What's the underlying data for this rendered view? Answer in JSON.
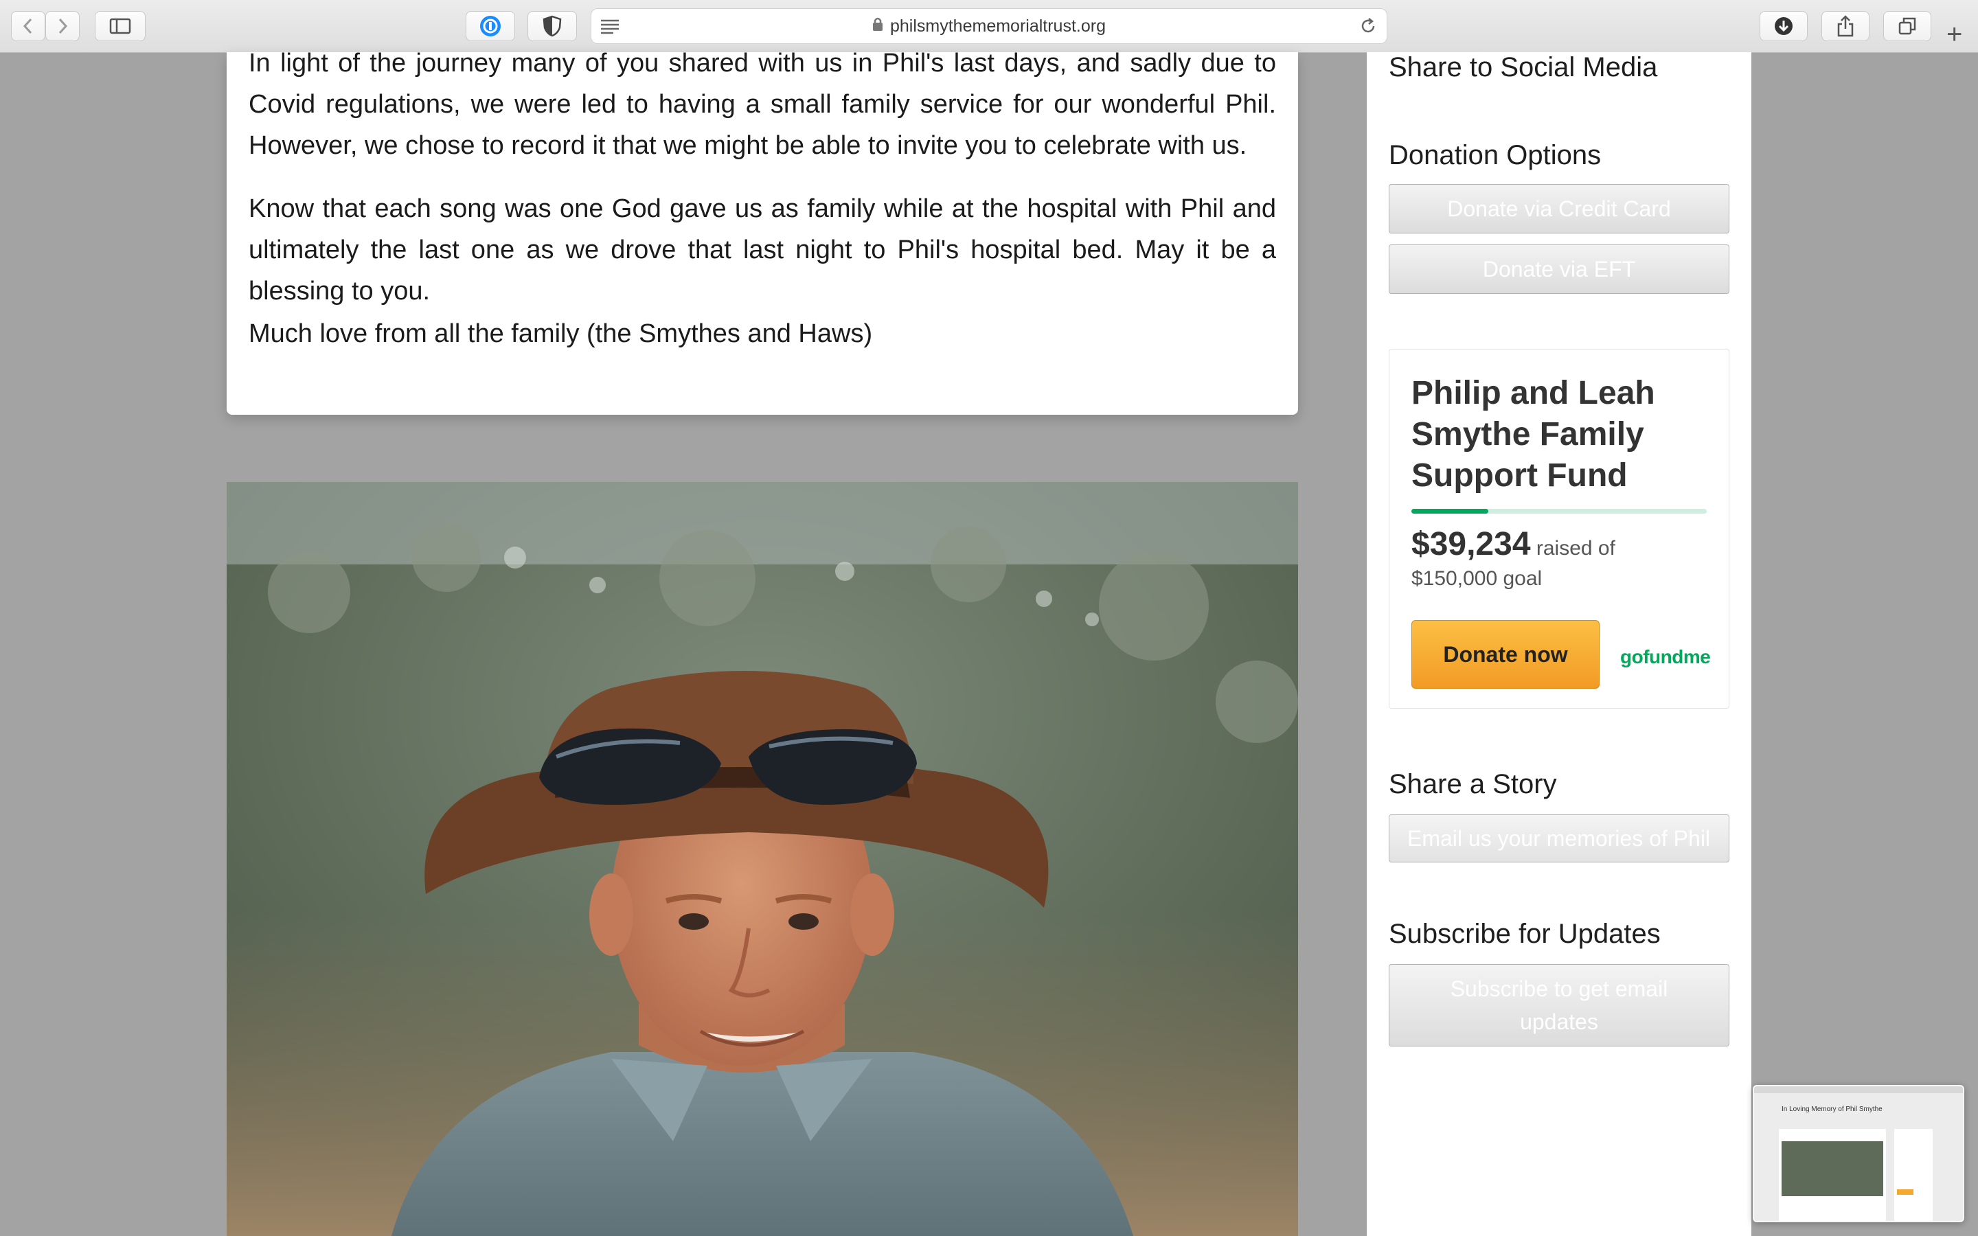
{
  "browser": {
    "url": "philsmythememorialtrust.org"
  },
  "article": {
    "paragraphs": [
      "In light of the journey many of you shared with us in Phil's last days, and sadly due to Covid regulations, we were led to having a small family service for our wonderful Phil. However, we chose to record it that we might be able to invite you to celebrate with us.",
      "Know that each song was one God gave us as family while at the hospital with Phil and ultimately the last one as we drove that last night to Phil's hospital bed. May it be a blessing to you.",
      "Much love from all the family (the Smythes and Haws)"
    ]
  },
  "sidebar": {
    "share_heading": "Share to Social Media",
    "donation_heading": "Donation Options",
    "donate_card_label": "Donate via Credit Card",
    "donate_eft_label": "Donate via EFT",
    "gofundme": {
      "title": "Philip and Leah Smythe Family Support Fund",
      "raised_amount": "$39,234",
      "raised_text": "raised of",
      "goal_text": "$150,000 goal",
      "progress_fraction": 0.26,
      "button_label": "Donate now",
      "logo_text": "gofundme",
      "brand_color": "#02a95c"
    },
    "story_heading": "Share a Story",
    "story_placeholder": "Email us your memories of Phil",
    "subscribe_heading": "Subscribe for Updates",
    "subscribe_label": "Subscribe to get email updates"
  },
  "thumbnail": {
    "title": "In Loving Memory of Phil Smythe"
  }
}
